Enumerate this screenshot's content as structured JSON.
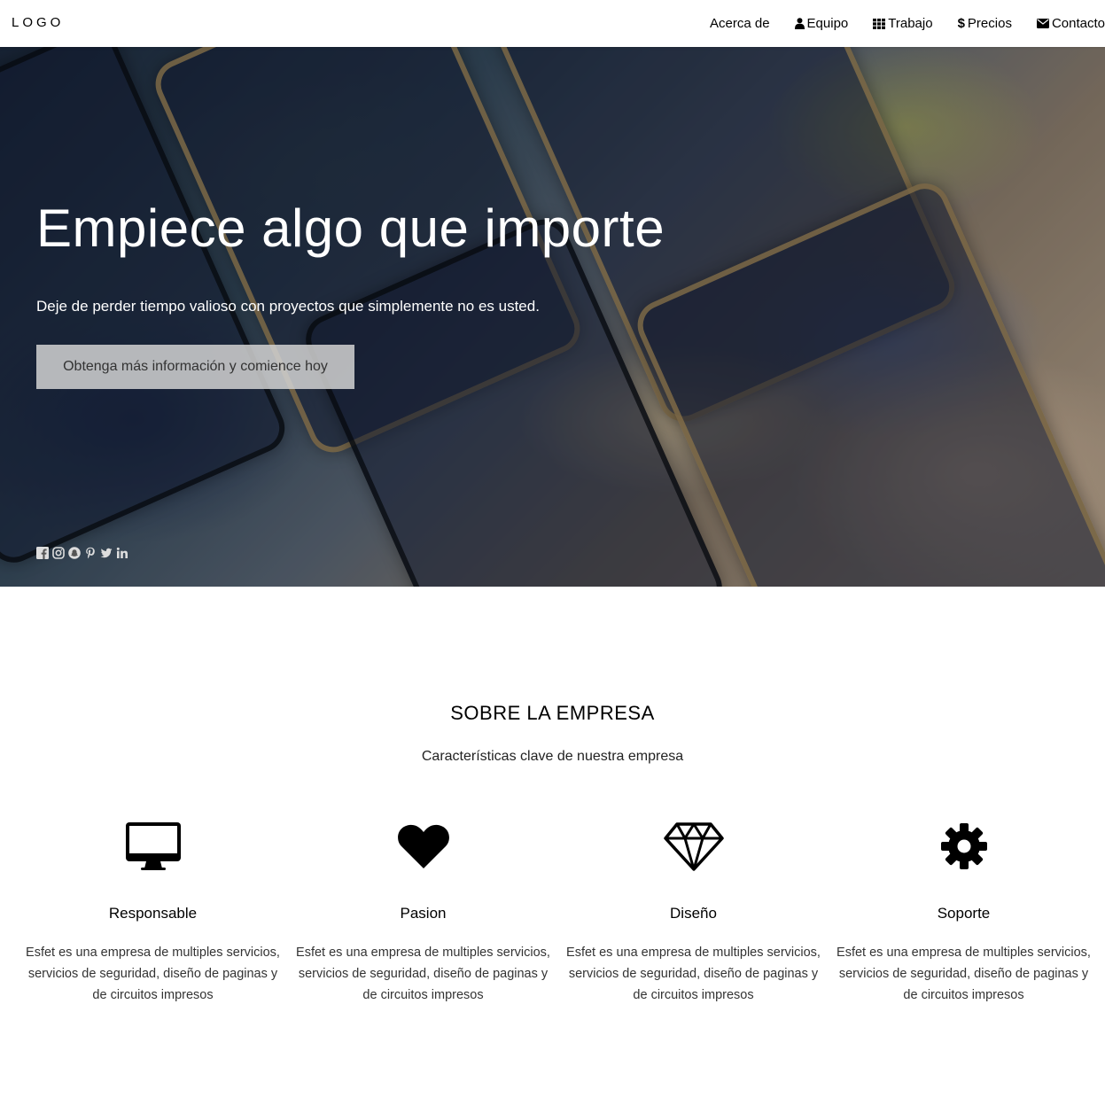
{
  "navbar": {
    "logo": "LOGO",
    "items": [
      {
        "label": "Acerca de",
        "icon": "none"
      },
      {
        "label": "Equipo",
        "icon": "user-icon"
      },
      {
        "label": "Trabajo",
        "icon": "grid-icon"
      },
      {
        "label": "Precios",
        "icon": "dollar-icon"
      },
      {
        "label": "Contacto",
        "icon": "envelope-icon"
      }
    ]
  },
  "hero": {
    "title": "Empiece algo que importe",
    "subtitle": "Deje de perder tiempo valioso con proyectos que simplemente no es usted.",
    "button_label": "Obtenga más información y comience hoy",
    "social_icons": [
      "facebook-icon",
      "instagram-icon",
      "snapchat-icon",
      "pinterest-icon",
      "twitter-icon",
      "linkedin-icon"
    ]
  },
  "about": {
    "title": "SOBRE LA EMPRESA",
    "subtitle": "Características clave de nuestra empresa",
    "features": [
      {
        "title": "Responsable",
        "icon": "desktop-icon",
        "text": "Esfet es una empresa de multiples servicios, servicios de seguridad, diseño de paginas y de circuitos impresos"
      },
      {
        "title": "Pasion",
        "icon": "heart-icon",
        "text": "Esfet es una empresa de multiples servicios, servicios de seguridad, diseño de paginas y de circuitos impresos"
      },
      {
        "title": "Diseño",
        "icon": "diamond-icon",
        "text": "Esfet es una empresa de multiples servicios, servicios de seguridad, diseño de paginas y de circuitos impresos"
      },
      {
        "title": "Soporte",
        "icon": "gear-icon",
        "text": "Esfet es una empresa de multiples servicios, servicios de seguridad, diseño de paginas y de circuitos impresos"
      }
    ]
  },
  "colors": {
    "text": "#000000",
    "hero_button_bg": "#d2d2d2",
    "hero_text": "#ffffff"
  }
}
